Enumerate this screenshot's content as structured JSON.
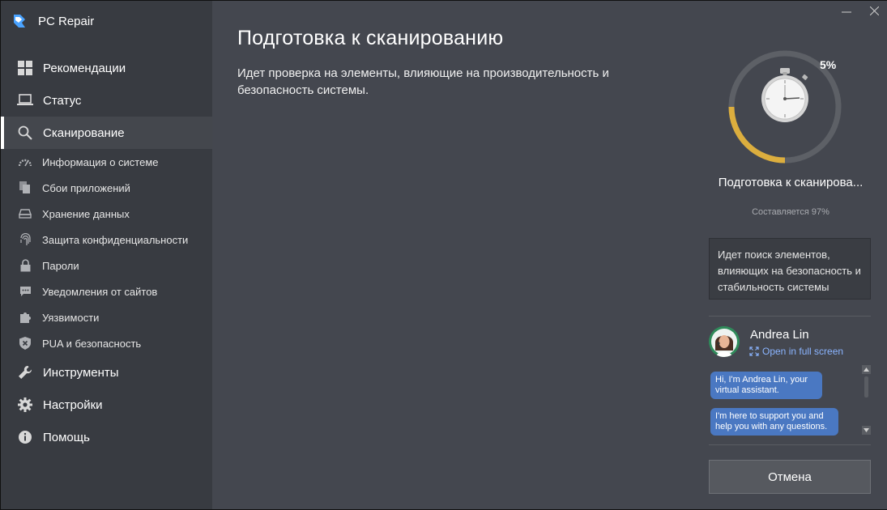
{
  "app": {
    "name": "PC Repair"
  },
  "colors": {
    "accent": "#e3b23c",
    "sidebar": "#383b41",
    "main": "#44474f",
    "bubble": "#4a78c2",
    "link": "#8ab4ff"
  },
  "sidebar": {
    "items": [
      {
        "label": "Рекомендации",
        "icon": "grid-icon"
      },
      {
        "label": "Статус",
        "icon": "laptop-icon"
      },
      {
        "label": "Сканирование",
        "icon": "search-icon",
        "active": true
      }
    ],
    "subitems": [
      {
        "label": "Информация о системе",
        "icon": "speedometer-icon"
      },
      {
        "label": "Сбои приложений",
        "icon": "copy-icon"
      },
      {
        "label": "Хранение данных",
        "icon": "drive-icon"
      },
      {
        "label": "Защита конфиденциальности",
        "icon": "fingerprint-icon"
      },
      {
        "label": "Пароли",
        "icon": "lock-icon"
      },
      {
        "label": "Уведомления от сайтов",
        "icon": "chat-icon"
      },
      {
        "label": "Уязвимости",
        "icon": "puzzle-icon"
      },
      {
        "label": "PUA и безопасность",
        "icon": "shield-x-icon"
      }
    ],
    "bottom_items": [
      {
        "label": "Инструменты",
        "icon": "wrench-icon"
      },
      {
        "label": "Настройки",
        "icon": "gear-icon"
      },
      {
        "label": "Помощь",
        "icon": "info-icon"
      }
    ]
  },
  "main": {
    "title": "Подготовка к сканированию",
    "description": "Идет проверка на элементы, влияющие на производительность и безопасность системы."
  },
  "progress": {
    "percent_label": "5%",
    "percent": 5,
    "title": "Подготовка к сканирова...",
    "subtitle": "Составляется 97%",
    "info": "Идет поиск элементов, влияющих на безопасность и стабильность системы"
  },
  "assistant": {
    "name": "Andrea Lin",
    "link_label": "Open in full screen",
    "messages": [
      "Hi, I'm Andrea Lin, your virtual assistant.",
      "I'm here to support you and help you with any questions."
    ]
  },
  "actions": {
    "cancel_label": "Отмена"
  }
}
